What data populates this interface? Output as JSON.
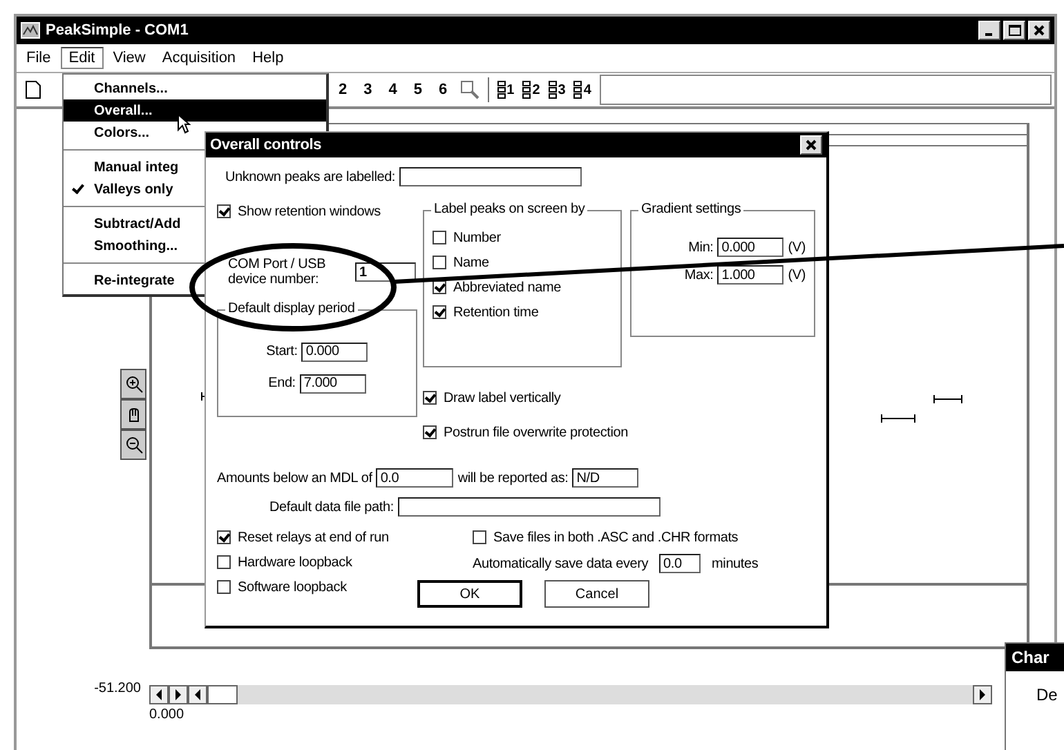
{
  "window": {
    "title": "PeakSimple - COM1"
  },
  "menu_bar": [
    {
      "label": "File",
      "selected": false
    },
    {
      "label": "Edit",
      "selected": true
    },
    {
      "label": "View",
      "selected": false
    },
    {
      "label": "Acquisition",
      "selected": false
    },
    {
      "label": "Help",
      "selected": false
    }
  ],
  "toolbar": {
    "numbers": [
      "2",
      "3",
      "4",
      "5",
      "6"
    ],
    "channel_buttons": [
      "1",
      "2",
      "3",
      "4"
    ]
  },
  "edit_menu": [
    {
      "kind": "item",
      "label": "Channels...",
      "selected": false,
      "checked": false
    },
    {
      "kind": "item",
      "label": "Overall...",
      "selected": true,
      "checked": false
    },
    {
      "kind": "item",
      "label": "Colors...",
      "selected": false,
      "checked": false
    },
    {
      "kind": "separator"
    },
    {
      "kind": "item",
      "label": "Manual integ",
      "selected": false,
      "checked": false
    },
    {
      "kind": "item",
      "label": "Valleys only",
      "selected": false,
      "checked": true
    },
    {
      "kind": "separator"
    },
    {
      "kind": "item",
      "label": "Subtract/Add",
      "selected": false,
      "checked": false
    },
    {
      "kind": "item",
      "label": "Smoothing...",
      "selected": false,
      "checked": false
    },
    {
      "kind": "separator"
    },
    {
      "kind": "item",
      "label": "Re-integrate",
      "selected": false,
      "checked": false
    }
  ],
  "dialog": {
    "title": "Overall controls",
    "unknown_peaks": {
      "label": "Unknown peaks are labelled:"
    },
    "show_retention_windows": {
      "label": "Show retention windows",
      "checked": true
    },
    "com_port": {
      "label": "COM Port / USB device number:",
      "value": "1"
    },
    "display_period": {
      "title": "Default display period",
      "start_label": "Start:",
      "start": "0.000",
      "end_label": "End:",
      "end": "7.000"
    },
    "label_peaks": {
      "title": "Label peaks on screen by",
      "options": [
        {
          "label": "Number",
          "checked": false
        },
        {
          "label": "Name",
          "checked": false
        },
        {
          "label": "Abbreviated name",
          "checked": true
        },
        {
          "label": "Retention time",
          "checked": true
        }
      ]
    },
    "gradient": {
      "title": "Gradient settings",
      "min_label": "Min:",
      "min": "0.000",
      "min_unit": "(V)",
      "max_label": "Max:",
      "max": "1.000",
      "max_unit": "(V)"
    },
    "draw_label_vertically": {
      "label": "Draw label vertically",
      "checked": true
    },
    "postrun_protection": {
      "label": "Postrun file overwrite protection",
      "checked": true
    },
    "mdl": {
      "label": "Amounts below an MDL of",
      "value": "0.0",
      "reported_label": "will be reported as:",
      "reported": "N/D"
    },
    "data_path": {
      "label": "Default data file path:"
    },
    "left_checks": [
      {
        "label": "Reset relays at end of run",
        "checked": true
      },
      {
        "label": "Hardware loopback",
        "checked": false
      },
      {
        "label": "Software loopback",
        "checked": false
      }
    ],
    "save_both": {
      "label": "Save files in both .ASC and .CHR formats",
      "checked": false
    },
    "autosave": {
      "label": "Automatically save data every",
      "value": "0.0",
      "unit": "minutes"
    },
    "buttons": [
      {
        "label": "OK",
        "default": true
      },
      {
        "label": "Cancel",
        "default": false
      }
    ]
  },
  "chart": {
    "y_label": "-51.200",
    "x_label": "0.000"
  },
  "other_window": {
    "title": "Char",
    "label": "De"
  }
}
